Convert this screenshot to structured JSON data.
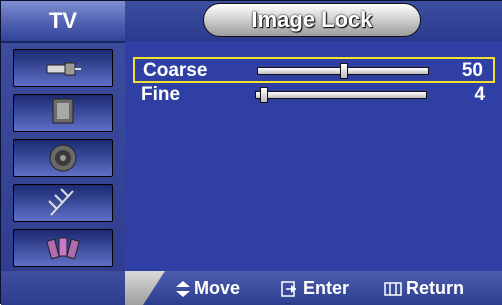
{
  "sidebar": {
    "label": "TV",
    "items": [
      {
        "icon": "input-plug-icon"
      },
      {
        "icon": "picture-panel-icon"
      },
      {
        "icon": "sound-speaker-icon"
      },
      {
        "icon": "channel-antenna-icon"
      },
      {
        "icon": "setup-plugs-icon"
      }
    ]
  },
  "header": {
    "title": "Image Lock"
  },
  "settings": [
    {
      "label": "Coarse",
      "value": "50",
      "level": 0.5,
      "selected": true
    },
    {
      "label": "Fine",
      "value": "4",
      "level": 0.04,
      "selected": false
    }
  ],
  "footer": {
    "move": "Move",
    "enter": "Enter",
    "return": "Return"
  },
  "colors": {
    "background": "#2f3fa4",
    "highlight": "#f2e12a"
  }
}
